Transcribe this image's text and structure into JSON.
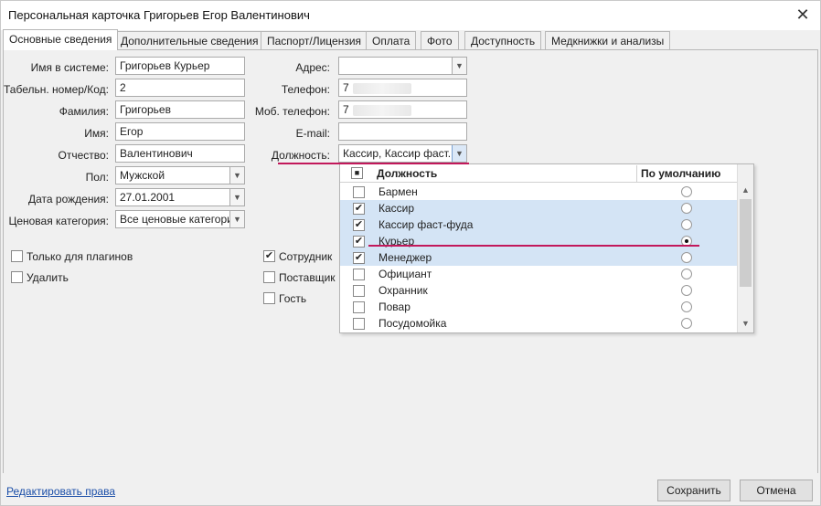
{
  "window": {
    "title": "Персональная карточка Григорьев Егор Валентинович"
  },
  "tabs": [
    "Основные сведения",
    "Дополнительные сведения",
    "Паспорт/Лицензия",
    "Оплата",
    "Фото",
    "Доступность",
    "Медкнижки и анализы"
  ],
  "left_form": {
    "system_name_label": "Имя в системе:",
    "system_name_value": "Григорьев Курьер",
    "tab_num_label": "Табельн. номер/Код:",
    "tab_num_value": "2",
    "surname_label": "Фамилия:",
    "surname_value": "Григорьев",
    "name_label": "Имя:",
    "name_value": "Егор",
    "patronymic_label": "Отчество:",
    "patronymic_value": "Валентинович",
    "gender_label": "Пол:",
    "gender_value": "Мужской",
    "birth_label": "Дата рождения:",
    "birth_value": "27.01.2001",
    "price_label": "Ценовая категория:",
    "price_value": "Все ценовые категории"
  },
  "right_form": {
    "address_label": "Адрес:",
    "address_value": "",
    "phone_label": "Телефон:",
    "phone_value": "7",
    "mobile_label": "Моб. телефон:",
    "mobile_value": "7",
    "email_label": "E-mail:",
    "email_value": "",
    "position_label": "Должность:",
    "position_value": "Кассир, Кассир фаст..."
  },
  "checkboxes_left": [
    {
      "label": "Только для плагинов",
      "checked": false
    },
    {
      "label": "Удалить",
      "checked": false
    }
  ],
  "checkboxes_mid": [
    {
      "label": "Сотрудник",
      "checked": true
    },
    {
      "label": "Поставщик",
      "checked": false
    },
    {
      "label": "Гость",
      "checked": false
    }
  ],
  "dropdown": {
    "col_position": "Должность",
    "col_default": "По умолчанию",
    "rows": [
      {
        "name": "Бармен",
        "checked": false,
        "default": false,
        "selected": false
      },
      {
        "name": "Кассир",
        "checked": true,
        "default": false,
        "selected": true
      },
      {
        "name": "Кассир фаст-фуда",
        "checked": true,
        "default": false,
        "selected": true
      },
      {
        "name": "Курьер",
        "checked": true,
        "default": true,
        "selected": true
      },
      {
        "name": "Менеджер",
        "checked": true,
        "default": false,
        "selected": true
      },
      {
        "name": "Официант",
        "checked": false,
        "default": false,
        "selected": false
      },
      {
        "name": "Охранник",
        "checked": false,
        "default": false,
        "selected": false
      },
      {
        "name": "Повар",
        "checked": false,
        "default": false,
        "selected": false
      },
      {
        "name": "Посудомойка",
        "checked": false,
        "default": false,
        "selected": false
      }
    ]
  },
  "footer": {
    "edit_rights": "Редактировать права",
    "save": "Сохранить",
    "cancel": "Отмена"
  },
  "colors": {
    "accent_underline": "#c2185b",
    "selected_row": "#d4e4f5",
    "link": "#1a4ea8"
  }
}
